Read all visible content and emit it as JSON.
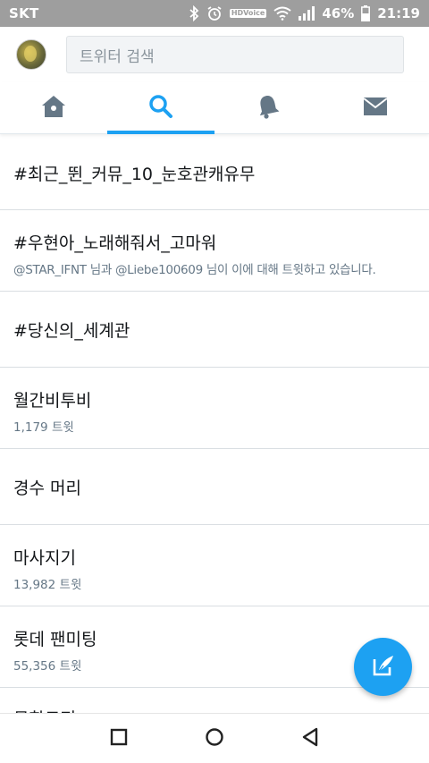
{
  "status_bar": {
    "carrier": "SKT",
    "hd_label": "HD",
    "voice_label": "Voice",
    "battery": "46%",
    "time": "21:19"
  },
  "search": {
    "placeholder": "트위터 검색"
  },
  "tabs": [
    {
      "icon": "home-icon",
      "active": false
    },
    {
      "icon": "search-icon",
      "active": true
    },
    {
      "icon": "bell-icon",
      "active": false
    },
    {
      "icon": "mail-icon",
      "active": false
    }
  ],
  "trends": [
    {
      "title": "#최근_뛴_커뮤_10_눈호관캐유무"
    },
    {
      "title": "#우현아_노래해줘서_고마워",
      "context": {
        "user1": "@STAR_IFNT",
        "mid": " 님과 ",
        "user2": "@Liebe100609",
        "tail": " 님이 이에 대해 트윗하고 있습니다."
      }
    },
    {
      "title": "#당신의_세계관"
    },
    {
      "title": "월간비투비",
      "count": "1,179 트윗"
    },
    {
      "title": "경수 머리"
    },
    {
      "title": "마사지기",
      "count": "13,982 트윗"
    },
    {
      "title": "롯데 팬미팅",
      "count": "55,356 트윗"
    },
    {
      "title": "문학도전"
    }
  ],
  "colors": {
    "accent": "#1da1f2",
    "icon_gray": "#657786"
  }
}
